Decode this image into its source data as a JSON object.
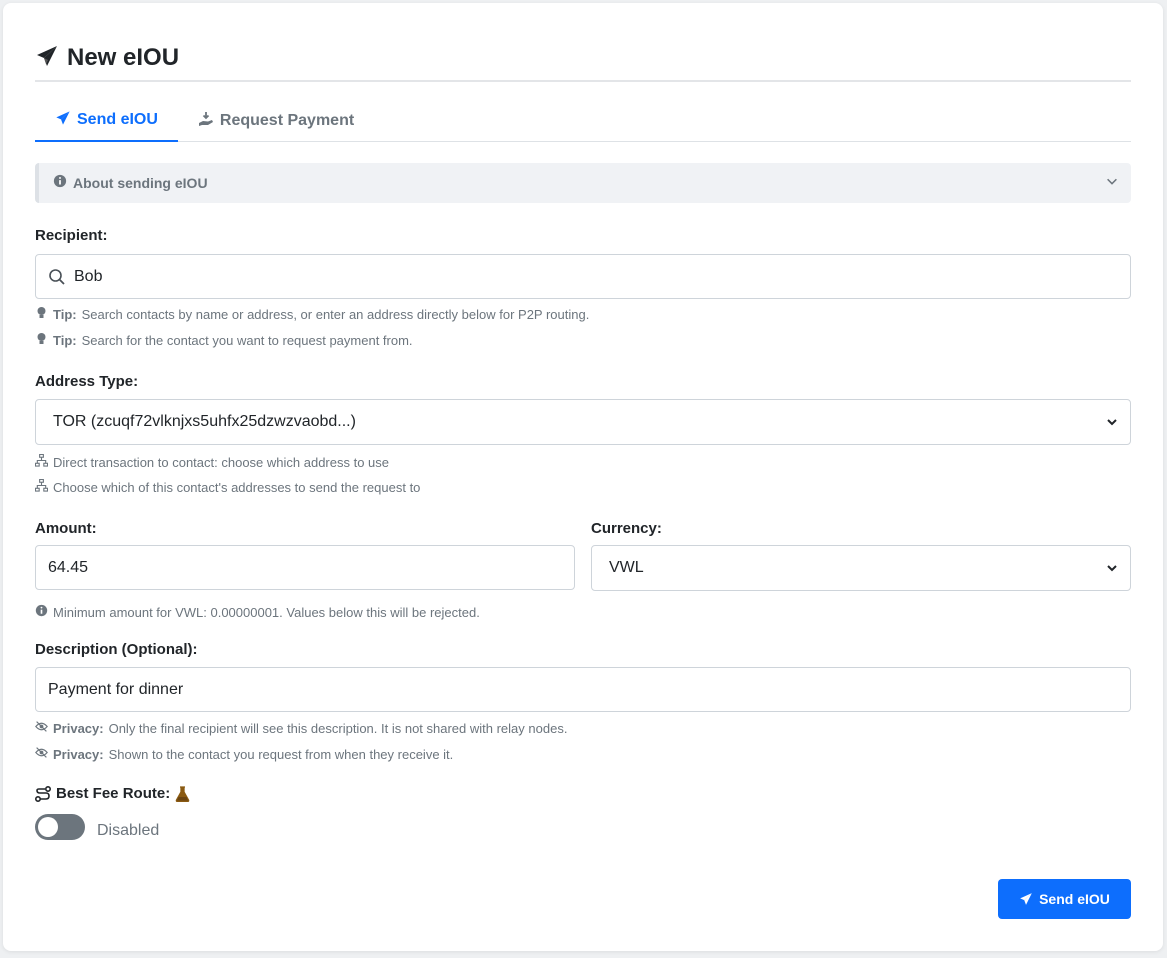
{
  "page": {
    "title": "New eIOU"
  },
  "tabs": [
    {
      "label": "Send eIOU",
      "active": true
    },
    {
      "label": "Request Payment",
      "active": false
    }
  ],
  "about": {
    "label": "About sending eIOU"
  },
  "recipient": {
    "label": "Recipient:",
    "value": "Bob",
    "tips": [
      {
        "prefix": "Tip:",
        "text": "Search contacts by name or address, or enter an address directly below for P2P routing."
      },
      {
        "prefix": "Tip:",
        "text": "Search for the contact you want to request payment from."
      }
    ]
  },
  "address_type": {
    "label": "Address Type:",
    "selected": "TOR (zcuqf72vlknjxs5uhfx25dzwzvaobd...)",
    "hints": [
      "Direct transaction to contact: choose which address to use",
      "Choose which of this contact's addresses to send the request to"
    ]
  },
  "amount": {
    "label": "Amount:",
    "value": "64.45"
  },
  "currency": {
    "label": "Currency:",
    "selected": "VWL"
  },
  "min_amount_hint": "Minimum amount for VWL: 0.00000001. Values below this will be rejected.",
  "description": {
    "label": "Description (Optional):",
    "value": "Payment for dinner",
    "hints": [
      {
        "prefix": "Privacy:",
        "text": "Only the final recipient will see this description. It is not shared with relay nodes."
      },
      {
        "prefix": "Privacy:",
        "text": "Shown to the contact you request from when they receive it."
      }
    ]
  },
  "best_fee_route": {
    "label": "Best Fee Route:",
    "state": "Disabled"
  },
  "submit": {
    "label": "Send eIOU"
  },
  "colors": {
    "primary": "#0d6efd",
    "muted": "#6c757d",
    "flask": "#8a5a12"
  }
}
